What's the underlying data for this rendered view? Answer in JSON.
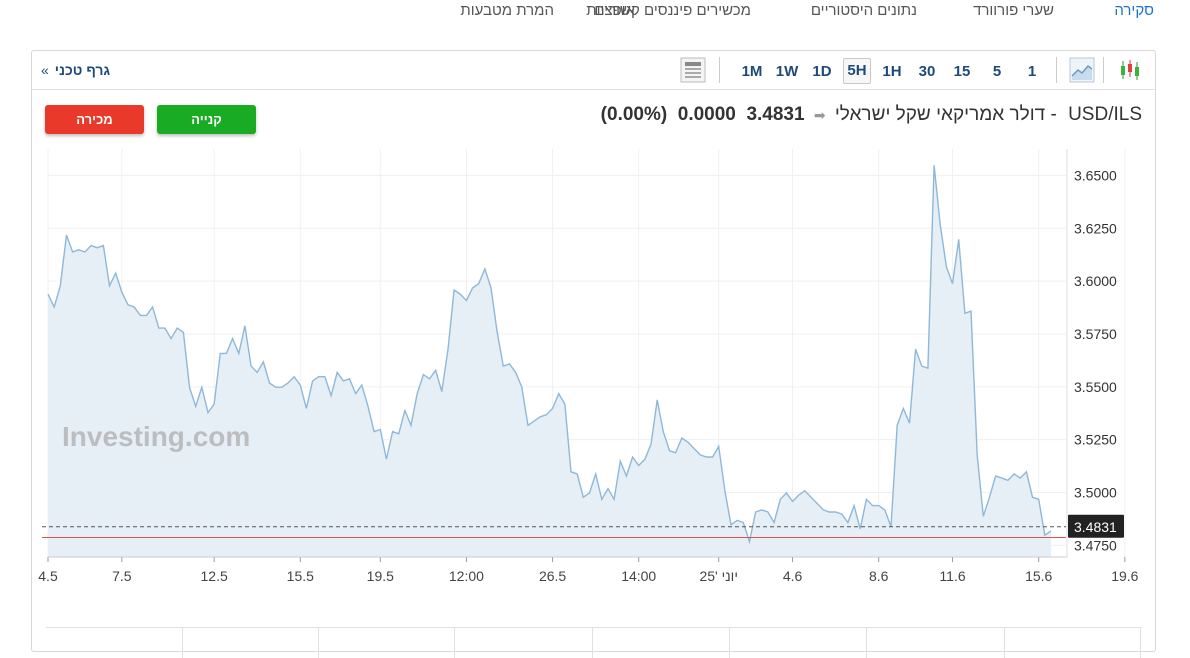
{
  "nav": {
    "items": [
      "סקירה",
      "שערי פורוורד",
      "נתונים היסטוריים",
      "מכשירים פיננסים קשורים",
      "אופציות",
      "המרת מטבעות"
    ],
    "active_index": 0
  },
  "toolbar": {
    "tech_chart_label": "גרף טכני",
    "tech_chart_arrow": "»",
    "timeframes": [
      "1",
      "5",
      "15",
      "30",
      "1H",
      "5H",
      "1D",
      "1W",
      "1M"
    ],
    "selected_timeframe": "5H",
    "icons": [
      "candlestick-chart-icon",
      "area-chart-icon",
      "chart-settings-icon"
    ]
  },
  "quote": {
    "pair": "USD/ILS",
    "name": "- דולר אמריקאי שקל ישראלי",
    "price": "3.4831",
    "change": "0.0000",
    "change_pct": "(0.00%)",
    "change_arrow": "➡"
  },
  "buttons": {
    "buy": "קנייה",
    "sell": "מכירה"
  },
  "colors": {
    "accent": "#1d4a7a",
    "buy": "#1aab24",
    "sell": "#e8392b",
    "line": "#8fb8d8",
    "area": "#e6eef6",
    "ref_line": "#e05050"
  },
  "chart_data": {
    "type": "area",
    "y_ticks": [
      "3.6500",
      "3.6250",
      "3.6000",
      "3.5750",
      "3.5500",
      "3.5250",
      "3.5000",
      "3.4750"
    ],
    "ylim": [
      3.4695,
      3.6625
    ],
    "x_tick_labels": [
      "4.5",
      "7.5",
      "12.5",
      "15.5",
      "19.5",
      "12:00",
      "26.5",
      "14:00",
      "יוני '25",
      "4.6",
      "8.6",
      "11.6",
      "15.6",
      "19.6"
    ],
    "x_tick_index": [
      0,
      12,
      27,
      41,
      54,
      68,
      82,
      96,
      109,
      121,
      135,
      147,
      161,
      175
    ],
    "current_price_label": "3.4831",
    "current_price": 3.4838,
    "reference_price": 3.4787,
    "watermark": "Investing.com",
    "values": [
      3.5938,
      3.5878,
      3.5978,
      3.6218,
      3.6138,
      3.6148,
      3.6138,
      3.6168,
      3.6158,
      3.6168,
      3.5978,
      3.6038,
      3.5948,
      3.5888,
      3.5878,
      3.5838,
      3.5838,
      3.5878,
      3.5778,
      3.5778,
      3.5728,
      3.5778,
      3.5758,
      3.5498,
      3.5408,
      3.5498,
      3.5378,
      3.5418,
      3.5658,
      3.5658,
      3.5728,
      3.5658,
      3.5788,
      3.5598,
      3.5568,
      3.5618,
      3.5518,
      3.5498,
      3.5498,
      3.5518,
      3.5548,
      3.5508,
      3.5398,
      3.5528,
      3.5548,
      3.5548,
      3.5458,
      3.5568,
      3.5528,
      3.5538,
      3.5468,
      3.5508,
      3.5408,
      3.5288,
      3.5298,
      3.5158,
      3.5288,
      3.5278,
      3.5388,
      3.5318,
      3.5468,
      3.5558,
      3.5538,
      3.5578,
      3.5478,
      3.5678,
      3.5958,
      3.5938,
      3.5908,
      3.5968,
      3.5988,
      3.6058,
      3.5968,
      3.5758,
      3.5598,
      3.5608,
      3.5568,
      3.5498,
      3.5318,
      3.5338,
      3.5358,
      3.5368,
      3.5398,
      3.5468,
      3.5418,
      3.5098,
      3.5088,
      3.4978,
      3.4998,
      3.5088,
      3.4968,
      3.5018,
      3.4968,
      3.5148,
      3.5078,
      3.5168,
      3.5128,
      3.5158,
      3.5228,
      3.5438,
      3.5288,
      3.5198,
      3.5188,
      3.5258,
      3.5238,
      3.5208,
      3.5178,
      3.5168,
      3.5168,
      3.5218,
      3.5008,
      3.4848,
      3.4868,
      3.4858,
      3.4768,
      3.4908,
      3.4918,
      3.4908,
      3.4858,
      3.4968,
      3.4998,
      3.4958,
      3.4988,
      3.5008,
      3.4978,
      3.4948,
      3.4918,
      3.4908,
      3.4908,
      3.4898,
      3.4858,
      3.4938,
      3.4828,
      3.4968,
      3.4938,
      3.4938,
      3.4918,
      3.4838,
      3.5318,
      3.5398,
      3.5328,
      3.5678,
      3.5598,
      3.5588,
      3.6548,
      3.6268,
      3.6068,
      3.5988,
      3.6198,
      3.5848,
      3.5858,
      3.5178,
      3.4888,
      3.4978,
      3.5078,
      3.5068,
      3.5058,
      3.5088,
      3.5068,
      3.5098,
      3.4978,
      3.4968,
      3.4798,
      3.4818
    ]
  }
}
